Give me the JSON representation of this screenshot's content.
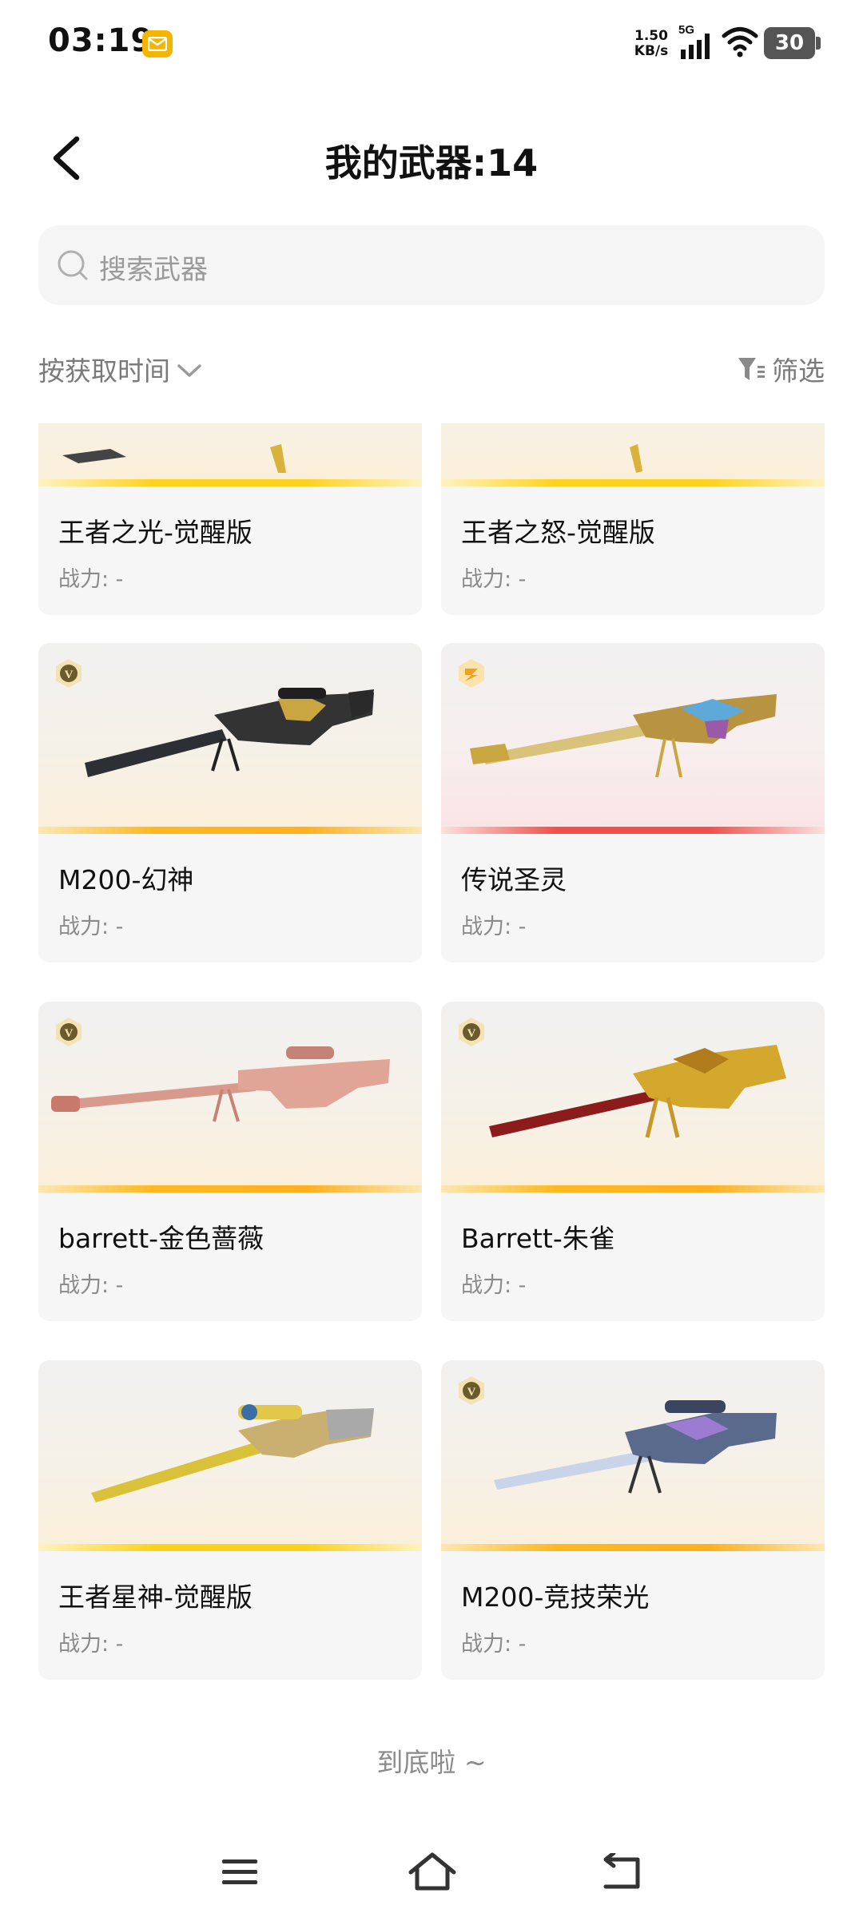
{
  "status_bar": {
    "time": "03:19",
    "net_speed_value": "1.50",
    "net_speed_unit": "KB/s",
    "network": "5G",
    "battery": "30"
  },
  "header": {
    "title": "我的武器:14"
  },
  "search": {
    "placeholder": "搜索武器"
  },
  "sort": {
    "label": "按获取时间"
  },
  "filter": {
    "label": "筛选"
  },
  "weapons": [
    {
      "name": "王者之光-觉醒版",
      "power": "战力: -",
      "rarity_color": "#ffd21e"
    },
    {
      "name": "王者之怒-觉醒版",
      "power": "战力: -",
      "rarity_color": "#ffd21e"
    },
    {
      "name": "M200-幻神",
      "power": "战力: -",
      "badge": "V",
      "rarity_color": "#ffb020"
    },
    {
      "name": "传说圣灵",
      "power": "战力: -",
      "badge": "legend",
      "rarity_color": "#f0504a"
    },
    {
      "name": "barrett-金色蔷薇",
      "power": "战力: -",
      "badge": "V",
      "rarity_color": "#ffb020"
    },
    {
      "name": "Barrett-朱雀",
      "power": "战力: -",
      "badge": "V",
      "rarity_color": "#ffb020"
    },
    {
      "name": "王者星神-觉醒版",
      "power": "战力: -",
      "rarity_color": "#ffd21e"
    },
    {
      "name": "M200-竞技荣光",
      "power": "战力: -",
      "badge": "V",
      "rarity_color": "#ffb020"
    }
  ],
  "footer": {
    "end_text": "到底啦 ~"
  },
  "icons": {
    "back": "chevron-left-icon",
    "search": "search-icon",
    "sort": "chevron-down-icon",
    "filter": "filter-icon"
  }
}
